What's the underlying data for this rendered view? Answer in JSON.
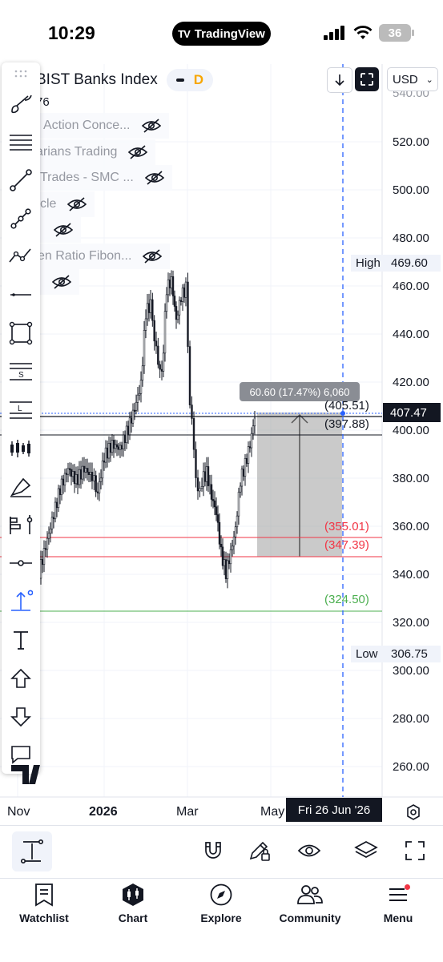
{
  "status_bar": {
    "time": "10:29",
    "app_pill": "TradingView",
    "battery": "36"
  },
  "header": {
    "symbol": "BIST Banks Index",
    "interval": "D",
    "currency": "USD",
    "ohlc_fragment": "76"
  },
  "indicators": [
    {
      "label": "Action Conce..."
    },
    {
      "label": "arians Trading"
    },
    {
      "label": "Trades - SMC ..."
    },
    {
      "label": "cle"
    },
    {
      "label": ""
    },
    {
      "label": "en Ratio Fibon..."
    },
    {
      "label": ""
    }
  ],
  "price_axis": {
    "ticks": [
      "520.00",
      "500.00",
      "480.00",
      "460.00",
      "440.00",
      "420.00",
      "400.00",
      "380.00",
      "360.00",
      "340.00",
      "320.00",
      "300.00",
      "280.00",
      "260.00"
    ],
    "high_label": "High",
    "high_value": "469.60",
    "low_label": "Low",
    "low_value": "306.75",
    "current_price": "407.47"
  },
  "time_axis": {
    "labels": [
      "Nov",
      "2026",
      "Mar",
      "May"
    ],
    "crosshair_date": "Fri 26 Jun '26"
  },
  "measure": {
    "tooltip": "60.60 (17.47%) 6,060"
  },
  "levels": [
    {
      "label": "(405.51)",
      "color": "#131722"
    },
    {
      "label": "(397.88)",
      "color": "#131722"
    },
    {
      "label": "(355.01)",
      "color": "#f23645"
    },
    {
      "label": "(347.39)",
      "color": "#f23645"
    },
    {
      "label": "(324.50)",
      "color": "#4caf50"
    }
  ],
  "tabs": [
    {
      "label": "Watchlist"
    },
    {
      "label": "Chart"
    },
    {
      "label": "Explore"
    },
    {
      "label": "Community"
    },
    {
      "label": "Menu"
    }
  ],
  "colors": {
    "accent": "#2962ff",
    "down": "#131722",
    "red_level": "#f23645",
    "green_level": "#4caf50",
    "notification": "#f23645"
  }
}
